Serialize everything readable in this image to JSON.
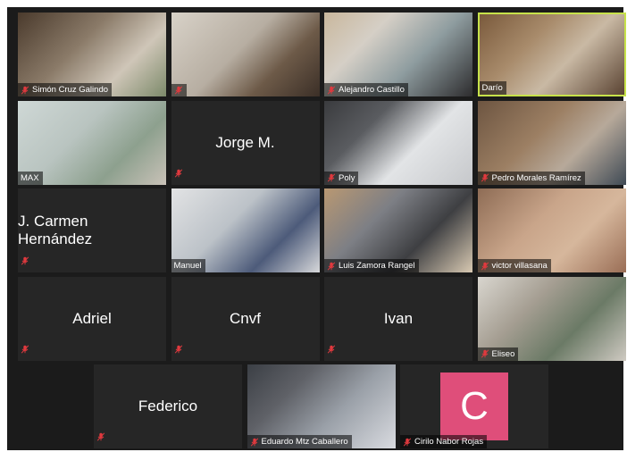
{
  "participants": [
    {
      "id": "simon",
      "name": "Simón Cruz Galindo",
      "muted": true,
      "video": true
    },
    {
      "id": "p2",
      "name": "",
      "muted": true,
      "video": true
    },
    {
      "id": "alejandro",
      "name": "Alejandro Castillo",
      "muted": true,
      "video": true
    },
    {
      "id": "dario",
      "name": "Darío",
      "muted": false,
      "video": true,
      "active_speaker": true
    },
    {
      "id": "max",
      "name": "MAX",
      "muted": false,
      "video": true
    },
    {
      "id": "jorge",
      "name": "Jorge M.",
      "muted": true,
      "video": false
    },
    {
      "id": "poly",
      "name": "Poly",
      "muted": true,
      "video": true
    },
    {
      "id": "pedro",
      "name": "Pedro Morales Ramírez",
      "muted": true,
      "video": true
    },
    {
      "id": "jcarmen",
      "name": "J. Carmen Hernández",
      "muted": true,
      "video": false
    },
    {
      "id": "manuel",
      "name": "Manuel",
      "muted": false,
      "video": true
    },
    {
      "id": "luis",
      "name": "Luis Zamora Rangel",
      "muted": true,
      "video": true
    },
    {
      "id": "victor",
      "name": "victor villasana",
      "muted": true,
      "video": true
    },
    {
      "id": "adriel",
      "name": "Adriel",
      "muted": true,
      "video": false
    },
    {
      "id": "cnvf",
      "name": "Cnvf",
      "muted": true,
      "video": false
    },
    {
      "id": "ivan",
      "name": "Ivan",
      "muted": true,
      "video": false
    },
    {
      "id": "eliseo",
      "name": "Eliseo",
      "muted": true,
      "video": true
    },
    {
      "id": "federico",
      "name": "Federico",
      "muted": true,
      "video": false
    },
    {
      "id": "eduardo",
      "name": "Eduardo Mtz Caballero",
      "muted": true,
      "video": true
    },
    {
      "id": "cirilo",
      "name": "Cirilo Nabor Rojas",
      "muted": true,
      "video": false,
      "avatar_letter": "C"
    }
  ],
  "colors": {
    "background": "#1b1b1b",
    "tile": "#262626",
    "active_border": "#c7e24a",
    "muted_icon": "#e0393e",
    "avatar": "#df4e7a"
  }
}
